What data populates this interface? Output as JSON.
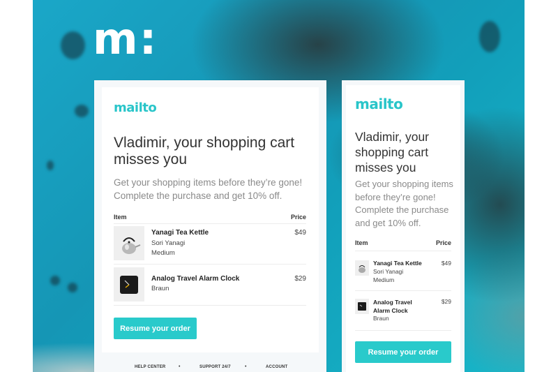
{
  "logo_mark": "m:",
  "colors": {
    "accent": "#29CACB",
    "brand_text": "#29C5C9",
    "background_sea": "#1AA7C8"
  },
  "desktop_email": {
    "brand": "mailto",
    "heading": "Vladimir, your shopping cart misses you",
    "subtext": "Get your shopping items before they’re gone! Complete the purchase and get 10% off.",
    "table": {
      "headers": {
        "item": "Item",
        "price": "Price"
      },
      "rows": [
        {
          "name": "Yanagi Tea Kettle",
          "maker": "Sori Yanagi",
          "variant": "Medium",
          "price": "$49",
          "image_icon": "kettle-icon"
        },
        {
          "name": "Analog Travel Alarm Clock",
          "maker": "Braun",
          "variant": "",
          "price": "$29",
          "image_icon": "clock-icon"
        }
      ]
    },
    "cta": "Resume your order",
    "footer": {
      "links": [
        "HELP CENTER",
        "SUPPORT 24/7",
        "ACCOUNT"
      ],
      "separator": "•"
    }
  },
  "mobile_email": {
    "brand": "mailto",
    "heading": "Vladimir, your shopping cart misses you",
    "subtext": "Get your shopping items before they’re gone! Complete the purchase and get 10% off.",
    "table": {
      "headers": {
        "item": "Item",
        "price": "Price"
      },
      "rows": [
        {
          "name": "Yanagi Tea Kettle",
          "maker": "Sori Yanagi",
          "variant": "Medium",
          "price": "$49",
          "image_icon": "kettle-icon"
        },
        {
          "name": "Analog Travel Alarm Clock",
          "maker": "Braun",
          "variant": "",
          "price": "$29",
          "image_icon": "clock-icon"
        }
      ]
    },
    "cta": "Resume your order"
  }
}
